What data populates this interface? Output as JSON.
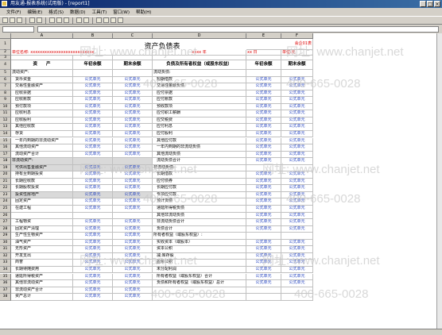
{
  "window": {
    "title": "用友通-报表系统(试用版) - [report1]"
  },
  "menu": [
    "文件(F)",
    "编辑(E)",
    "格式(S)",
    "数据(D)",
    "工具(T)",
    "窗口(W)",
    "帮助(H)"
  ],
  "sheet": {
    "title": "资产负债表",
    "unit_label": "会企01表",
    "unit_row": "单位名称: xxxxxxxxxxxxxxxxxxxxxxxxxxx",
    "date_year": "xxxx 年",
    "date_day": "xx 日",
    "currency_label": "单位:元",
    "col_letters": [
      "A",
      "B",
      "C",
      "D",
      "E",
      "F"
    ],
    "headers": [
      "资　　产",
      "年初余额",
      "期末余额",
      "负债及所有者权益（或股东权益）",
      "年初余额",
      "期末余额"
    ],
    "formula_text": "公式单元",
    "left_items": [
      "流动资产:",
      "货币资金",
      "交易性金融资产",
      "应收票据",
      "应收账款",
      "预付款项",
      "应收利息",
      "应收股利",
      "其他应收款",
      "存货",
      "一年内到期的非流动资产",
      "其他流动资产",
      "流动资产合计",
      "非流动资产:",
      "可供出售金融资产",
      "持有至到期投资",
      "长期应收款",
      "长期股权投资",
      "投资性房地产",
      "固定资产",
      "在建工程",
      "",
      "工程物资",
      "固定资产清理",
      "生产性生物资产",
      "油气资产",
      "无形资产",
      "开发支出",
      "商誉",
      "长期待摊费用",
      "递延所得税资产",
      "其他非流动资产",
      "非流动资产合计",
      "资产总计"
    ],
    "right_items": [
      "流动负债:",
      "短期借款",
      "交易性金融负债",
      "应付票据",
      "应付账款",
      "预收款项",
      "应付职工薪酬",
      "应交税费",
      "应付利息",
      "应付股利",
      "其他应付款",
      "一年内到期的非流动负债",
      "其他流动负债",
      "流动负债合计",
      "非流动负债:",
      "长期借款",
      "应付债券",
      "长期应付款",
      "专项应付款",
      "预计负债",
      "递延所得税负债",
      "其他非流动负债",
      "非流动负债合计",
      "负债合计",
      "所有者权益（或股东权益）:",
      "实收资本（或股本）",
      "资本公积",
      "减:库存股",
      "盈余公积",
      "未分配利润",
      "所有者权益（或股东权益）合计",
      "负债和所有者权益（或股东权益）总计"
    ]
  },
  "watermark": [
    "网址: www.chanjet.net",
    "400-665-0028"
  ]
}
